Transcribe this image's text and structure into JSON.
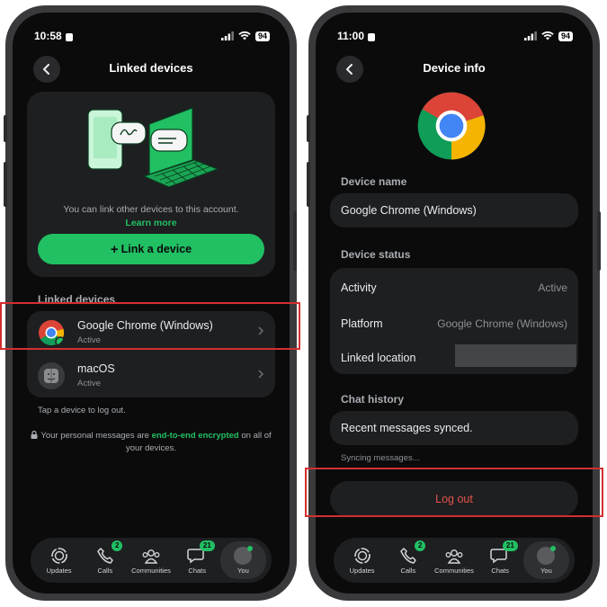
{
  "left": {
    "status": {
      "time": "10:58",
      "battery": "94"
    },
    "header": {
      "title": "Linked devices"
    },
    "promo": {
      "text": "You can link other devices to this account.",
      "link": "Learn more",
      "button_plus": "+",
      "button_label": "Link a device"
    },
    "section_label": "Linked devices",
    "devices": [
      {
        "name": "Google Chrome (Windows)",
        "status": "Active",
        "icon": "chrome-icon"
      },
      {
        "name": "macOS",
        "status": "Active",
        "icon": "finder-icon"
      }
    ],
    "hint": "Tap a device to log out.",
    "e2e": {
      "prefix": "Your personal messages are ",
      "link": "end-to-end encrypted",
      "suffix": " on all of your devices."
    }
  },
  "right": {
    "status": {
      "time": "11:00",
      "battery": "94"
    },
    "header": {
      "title": "Device info"
    },
    "device_name_label": "Device name",
    "device_name": "Google Chrome (Windows)",
    "device_status_label": "Device status",
    "status_rows": [
      {
        "label": "Activity",
        "value": "Active"
      },
      {
        "label": "Platform",
        "value": "Google Chrome (Windows)"
      },
      {
        "label": "Linked location",
        "value": ""
      }
    ],
    "chat_history_label": "Chat history",
    "chat_history_value": "Recent messages synced.",
    "syncing_text": "Syncing messages...",
    "logout_label": "Log out"
  },
  "nav": {
    "items": [
      {
        "label": "Updates",
        "icon": "updates-icon",
        "badge": ""
      },
      {
        "label": "Calls",
        "icon": "calls-icon",
        "badge": "2"
      },
      {
        "label": "Communities",
        "icon": "communities-icon",
        "badge": ""
      },
      {
        "label": "Chats",
        "icon": "chats-icon",
        "badge": "21"
      },
      {
        "label": "You",
        "icon": "avatar",
        "badge": ""
      }
    ]
  },
  "colors": {
    "accent": "#21c063",
    "background": "#0b0b0c",
    "card": "#1e1f21",
    "danger": "#e5534b",
    "highlight": "#d32f2f"
  }
}
